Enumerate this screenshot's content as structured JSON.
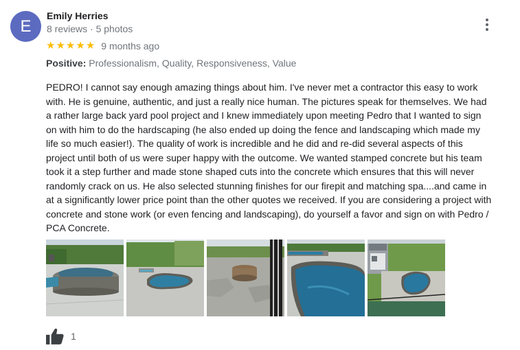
{
  "reviewer": {
    "initial": "E",
    "avatar_color": "#5c6bc0",
    "name": "Emily Herries",
    "meta": "8 reviews · 5 photos"
  },
  "rating": {
    "stars": 5,
    "max_stars": 5,
    "star_color": "#fbbc04",
    "time": "9 months ago"
  },
  "positive": {
    "label": "Positive:",
    "value": " Professionalism, Quality, Responsiveness, Value"
  },
  "review_text": "PEDRO! I cannot say enough amazing things about him. I've never met a contractor this easy to work\nwith. He is genuine, authentic, and just a really nice human. The pictures speak for themselves. We had\na rather large back yard pool project and I knew immediately upon meeting Pedro that I wanted to sign\non with him to do the hardscaping (he also ended up doing the fence and landscaping which made my\nlife so much easier!). The quality of work is incredible and he did and re-did several aspects of this\nproject until both of us were super happy with the outcome. We wanted stamped concrete but his team\ntook it a step further and made stone shaped cuts into the concrete which  ensures that this will never\nrandomly crack on us. He also selected stunning finishes for our firepit and matching spa....and came in\nat a significantly lower price point than the other quotes we received. If you are considering a project with\nconcrete and stone work (or even fencing and landscaping), do yourself a favor and sign on with Pedro /\nPCA Concrete.",
  "photos": [
    {
      "icon": "photo-spa-patio"
    },
    {
      "icon": "photo-pool-trees"
    },
    {
      "icon": "photo-firepit"
    },
    {
      "icon": "photo-pool-closeup"
    },
    {
      "icon": "photo-pool-aerial"
    }
  ],
  "likes": {
    "icon": "thumbs-up-icon",
    "count": "1"
  },
  "more_icon": "more-vert-icon"
}
